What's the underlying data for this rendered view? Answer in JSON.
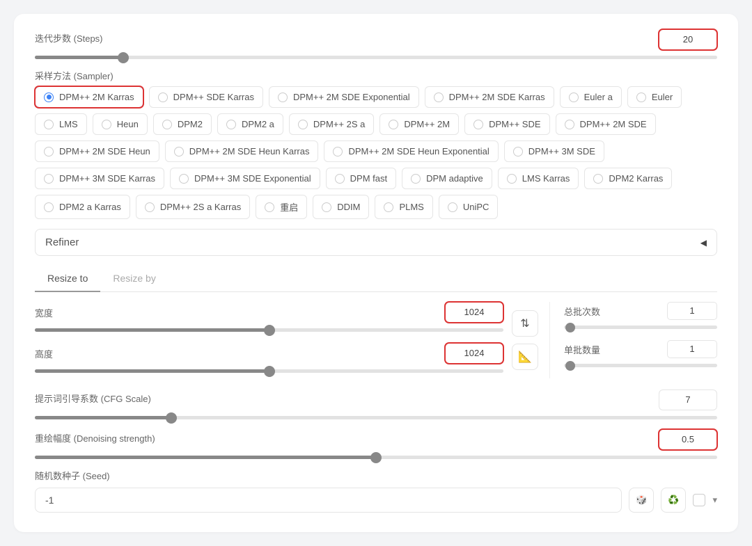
{
  "steps": {
    "label": "迭代步数 (Steps)",
    "value": "20",
    "fill_pct": 13
  },
  "sampler": {
    "label": "采样方法 (Sampler)",
    "selected": "DPM++ 2M Karras",
    "options": [
      "DPM++ 2M Karras",
      "DPM++ SDE Karras",
      "DPM++ 2M SDE Exponential",
      "DPM++ 2M SDE Karras",
      "Euler a",
      "Euler",
      "LMS",
      "Heun",
      "DPM2",
      "DPM2 a",
      "DPM++ 2S a",
      "DPM++ 2M",
      "DPM++ SDE",
      "DPM++ 2M SDE",
      "DPM++ 2M SDE Heun",
      "DPM++ 2M SDE Heun Karras",
      "DPM++ 2M SDE Heun Exponential",
      "DPM++ 3M SDE",
      "DPM++ 3M SDE Karras",
      "DPM++ 3M SDE Exponential",
      "DPM fast",
      "DPM adaptive",
      "LMS Karras",
      "DPM2 Karras",
      "DPM2 a Karras",
      "DPM++ 2S a Karras",
      "重启",
      "DDIM",
      "PLMS",
      "UniPC"
    ]
  },
  "refiner": {
    "label": "Refiner"
  },
  "resize": {
    "tabs": [
      "Resize to",
      "Resize by"
    ],
    "active_tab": 0,
    "width": {
      "label": "宽度",
      "value": "1024",
      "fill_pct": 50
    },
    "height": {
      "label": "高度",
      "value": "1024",
      "fill_pct": 50
    },
    "swap_icon": "⇅",
    "ruler_icon": "📐"
  },
  "batch": {
    "count": {
      "label": "总批次数",
      "value": "1"
    },
    "size": {
      "label": "单批数量",
      "value": "1"
    }
  },
  "cfg": {
    "label": "提示词引导系数 (CFG Scale)",
    "value": "7",
    "fill_pct": 20
  },
  "denoise": {
    "label": "重绘幅度 (Denoising strength)",
    "value": "0.5",
    "fill_pct": 50
  },
  "seed": {
    "label": "随机数种子 (Seed)",
    "value": "-1",
    "dice_icon": "🎲",
    "recycle_icon": "♻️"
  }
}
